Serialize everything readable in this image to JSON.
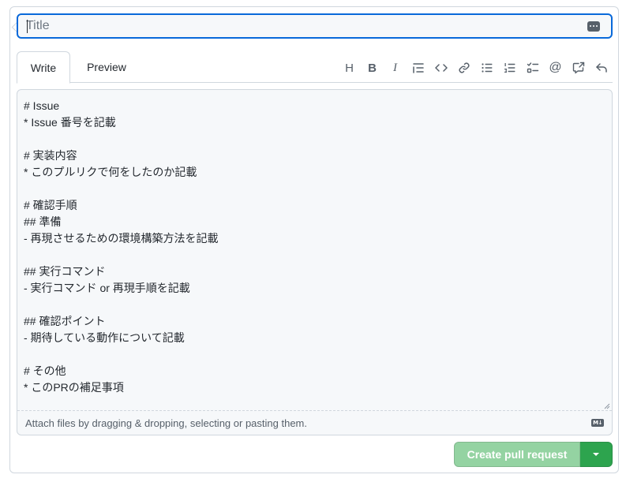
{
  "title_field": {
    "value": "",
    "placeholder": "Title"
  },
  "tabs": [
    {
      "label": "Write",
      "active": true
    },
    {
      "label": "Preview",
      "active": false
    }
  ],
  "toolbar": {
    "icons": [
      "heading-icon",
      "bold-icon",
      "italic-icon",
      "quote-icon",
      "code-icon",
      "link-icon",
      "unordered-list-icon",
      "ordered-list-icon",
      "task-list-icon",
      "mention-icon",
      "cross-reference-icon",
      "reply-icon"
    ],
    "heading": "H",
    "bold": "B",
    "italic": "I",
    "mention": "@"
  },
  "body": {
    "value": "# Issue\n* Issue 番号を記載\n\n# 実装内容\n* このプルリクで何をしたのか記載\n\n# 確認手順\n## 準備\n- 再現させるための環境構築方法を記載\n\n## 実行コマンド\n- 実行コマンド or 再現手順を記載\n\n## 確認ポイント\n- 期待している動作について記載\n\n# その他\n* このPRの補足事項"
  },
  "attach": {
    "text": "Attach files by dragging & dropping, selecting or pasting them.",
    "markdown_badge": "M↓"
  },
  "actions": {
    "create_label": "Create pull request",
    "create_enabled": false
  },
  "colors": {
    "focus_border": "#0969da",
    "primary_green": "#2da44e",
    "disabled_green": "#94d3a2",
    "muted_text": "#57606a"
  }
}
